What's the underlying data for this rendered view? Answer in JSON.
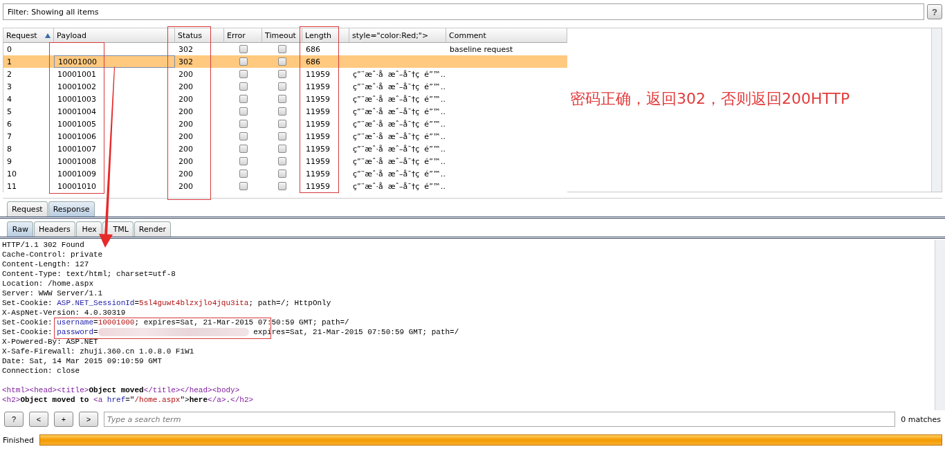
{
  "filter": {
    "label": "Filter: Showing all items",
    "help": "?"
  },
  "table": {
    "columns": [
      {
        "label": "Request",
        "sorted": true
      },
      {
        "label": "Payload",
        "sorted": false
      },
      {
        "label": "Status",
        "sorted": false
      },
      {
        "label": "Error",
        "sorted": false
      },
      {
        "label": "Timeout",
        "sorted": false
      },
      {
        "label": "Length",
        "sorted": false
      },
      {
        "label": "style=\"color:Red;\">",
        "sorted": false
      },
      {
        "label": "Comment",
        "sorted": false
      }
    ],
    "rows": [
      {
        "request": "0",
        "status": "302",
        "error": false,
        "timeout": false,
        "length": "686",
        "comment": "baseline request",
        "selected": false
      },
      {
        "request": "1",
        "payload": "10001000",
        "status": "302",
        "error": false,
        "timeout": false,
        "length": "686",
        "selected": true
      },
      {
        "request": "2",
        "payload": "10001001",
        "status": "200",
        "error": false,
        "timeout": false,
        "length": "11959",
        "column_7": "ç”¨æˆ·å  æˆ–å¯†ç  é”™…",
        "selected": false
      },
      {
        "request": "3",
        "payload": "10001002",
        "status": "200",
        "error": false,
        "timeout": false,
        "length": "11959",
        "column_7": "ç”¨æˆ·å  æˆ–å¯†ç  é”™…",
        "selected": false
      },
      {
        "request": "4",
        "payload": "10001003",
        "status": "200",
        "error": false,
        "timeout": false,
        "length": "11959",
        "column_7": "ç”¨æˆ·å  æˆ–å¯†ç  é”™…",
        "selected": false
      },
      {
        "request": "5",
        "payload": "10001004",
        "status": "200",
        "error": false,
        "timeout": false,
        "length": "11959",
        "column_7": "ç”¨æˆ·å  æˆ–å¯†ç  é”™…",
        "selected": false
      },
      {
        "request": "6",
        "payload": "10001005",
        "status": "200",
        "error": false,
        "timeout": false,
        "length": "11959",
        "column_7": "ç”¨æˆ·å  æˆ–å¯†ç  é”™…",
        "selected": false
      },
      {
        "request": "7",
        "payload": "10001006",
        "status": "200",
        "error": false,
        "timeout": false,
        "length": "11959",
        "column_7": "ç”¨æˆ·å  æˆ–å¯†ç  é”™…",
        "selected": false
      },
      {
        "request": "8",
        "payload": "10001007",
        "status": "200",
        "error": false,
        "timeout": false,
        "length": "11959",
        "column_7": "ç”¨æˆ·å  æˆ–å¯†ç  é”™…",
        "selected": false
      },
      {
        "request": "9",
        "payload": "10001008",
        "status": "200",
        "error": false,
        "timeout": false,
        "length": "11959",
        "column_7": "ç”¨æˆ·å  æˆ–å¯†ç  é”™…",
        "selected": false
      },
      {
        "request": "10",
        "payload": "10001009",
        "status": "200",
        "error": false,
        "timeout": false,
        "length": "11959",
        "column_7": "ç”¨æˆ·å  æˆ–å¯†ç  é”™…",
        "selected": false
      },
      {
        "request": "11",
        "payload": "10001010",
        "status": "200",
        "error": false,
        "timeout": false,
        "length": "11959",
        "column_7": "ç”¨æˆ·å  æˆ–å¯†ç  é”™…",
        "selected": false
      }
    ]
  },
  "annotation": "密码正确，返回302，否则返回200HTTP",
  "message_tabs": [
    {
      "label": "Request",
      "selected": false
    },
    {
      "label": "Response",
      "selected": true
    }
  ],
  "view_tabs": [
    {
      "label": "Raw",
      "selected": true
    },
    {
      "label": "Headers",
      "selected": false
    },
    {
      "label": "Hex",
      "selected": false
    },
    {
      "label": "TML",
      "selected": false
    },
    {
      "label": "Render",
      "selected": false
    }
  ],
  "response_headers": [
    [
      {
        "kind": "plain",
        "text": "HTTP/1.1 302 Found"
      }
    ],
    [
      {
        "kind": "plain",
        "text": "Cache-Control: private"
      }
    ],
    [
      {
        "kind": "plain",
        "text": "Content-Length: 127"
      }
    ],
    [
      {
        "kind": "plain",
        "text": "Content-Type: text/html; charset=utf-8"
      }
    ],
    [
      {
        "kind": "plain",
        "text": "Location: /home.aspx"
      }
    ],
    [
      {
        "kind": "plain",
        "text": "Server: WWW Server/1.1"
      }
    ],
    [
      {
        "kind": "plain",
        "text": "Set-Cookie: "
      },
      {
        "kind": "name",
        "text": "ASP.NET_SessionId"
      },
      {
        "kind": "plain",
        "text": "="
      },
      {
        "kind": "value",
        "text": "5sl4guwt4blzxjlo4jqu3ita"
      },
      {
        "kind": "plain",
        "text": "; path=/; HttpOnly"
      }
    ],
    [
      {
        "kind": "plain",
        "text": "X-AspNet-Version: 4.0.30319"
      }
    ],
    [
      {
        "kind": "plain",
        "text": "Set-Cookie: "
      },
      {
        "kind": "name",
        "text": "username"
      },
      {
        "kind": "plain",
        "text": "="
      },
      {
        "kind": "value",
        "text": "10001000"
      },
      {
        "kind": "plain",
        "text": "; expires=Sat, 21-Mar-2015 07:50:59 GMT; path=/"
      }
    ],
    [
      {
        "kind": "plain",
        "text": "Set-Cookie: "
      },
      {
        "kind": "name",
        "text": "password"
      },
      {
        "kind": "plain",
        "text": "="
      },
      {
        "kind": "redacted"
      },
      {
        "kind": "plain",
        "text": " expires=Sat, 21-Mar-2015 07:50:59 GMT; path=/"
      }
    ],
    [
      {
        "kind": "plain",
        "text": "X-Powered-By: ASP.NET"
      }
    ],
    [
      {
        "kind": "plain",
        "text": "X-Safe-Firewall: zhuji.360.cn 1.0.8.0 F1W1"
      }
    ],
    [
      {
        "kind": "plain",
        "text": "Date: Sat, 14 Mar 2015 09:10:59 GMT"
      }
    ],
    [
      {
        "kind": "plain",
        "text": "Connection: close"
      }
    ]
  ],
  "response_body": [
    [
      {
        "kind": "tag",
        "text": "<html>"
      },
      {
        "kind": "tag",
        "text": "<head>"
      },
      {
        "kind": "tag",
        "text": "<title>"
      },
      {
        "kind": "bold",
        "text": "Object moved"
      },
      {
        "kind": "tag",
        "text": "</title>"
      },
      {
        "kind": "tag",
        "text": "</head>"
      },
      {
        "kind": "tag",
        "text": "<body>"
      }
    ],
    [
      {
        "kind": "tag",
        "text": "<h2>"
      },
      {
        "kind": "bold",
        "text": "Object moved to "
      },
      {
        "kind": "tag",
        "text": "<a "
      },
      {
        "kind": "name",
        "text": "href"
      },
      {
        "kind": "plain",
        "text": "=\""
      },
      {
        "kind": "value",
        "text": "/home.aspx"
      },
      {
        "kind": "plain",
        "text": "\">"
      },
      {
        "kind": "bold",
        "text": "here"
      },
      {
        "kind": "tag",
        "text": "</a>"
      },
      {
        "kind": "plain",
        "text": "."
      },
      {
        "kind": "tag",
        "text": "</h2>"
      }
    ]
  ],
  "search": {
    "buttons": [
      "?",
      "<",
      "+",
      ">"
    ],
    "placeholder": "Type a search term",
    "matches": "0 matches"
  },
  "status": {
    "label": "Finished",
    "level": 1
  }
}
